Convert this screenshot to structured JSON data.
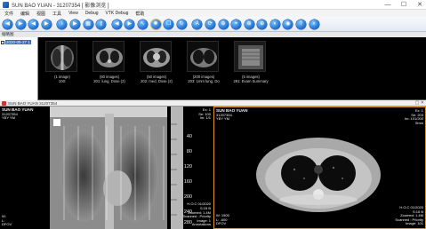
{
  "window": {
    "title": "SUN BAO YUAN - 31207354 [ 影像浏览 ]",
    "minimize": "—",
    "maximize": "☐",
    "close": "✕"
  },
  "menu": [
    "文件",
    "编辑",
    "视图",
    "工具",
    "View",
    "Debug",
    "VTK Debug",
    "帮助"
  ],
  "toolbar": {
    "buttons": [
      {
        "icon": "arrow-left-icon"
      },
      {
        "icon": "arrow-right-icon"
      },
      {
        "icon": "arrow-left-icon"
      },
      {
        "icon": "arrow-right-icon"
      },
      {
        "icon": "info-icon"
      },
      {
        "icon": "arrow-right-icon"
      },
      {
        "icon": "layout-icon"
      },
      {
        "icon": "key-icon"
      },
      {
        "icon": "arrow-left-icon"
      },
      {
        "icon": "arrow-right-icon"
      },
      {
        "icon": "pointer-icon"
      },
      {
        "icon": "settings-icon"
      },
      {
        "icon": "copy-icon"
      },
      {
        "icon": "rotate-icon"
      },
      {
        "icon": "text-a-icon"
      },
      {
        "icon": "refresh-icon"
      },
      {
        "icon": "zoom-icon"
      },
      {
        "icon": "measure-icon"
      },
      {
        "icon": "zoom-icon"
      },
      {
        "icon": "zoom-icon"
      },
      {
        "icon": "contrast-icon"
      },
      {
        "icon": "camera-icon"
      },
      {
        "icon": "help-icon"
      },
      {
        "icon": "search-icon"
      }
    ]
  },
  "thumbnails": {
    "panel_label": "缩略图",
    "study_date": "2020-05-27 1",
    "items": [
      {
        "count": "(1 image)",
        "label": "100:"
      },
      {
        "count": "(50 images)",
        "label": "201: lung, Dose (2)"
      },
      {
        "count": "(50 images)",
        "label": "202: med, Dose (2)"
      },
      {
        "count": "(200 images)",
        "label": "203: 1mm lung, Do"
      },
      {
        "count": "(5 images)",
        "label": "291: Exam Summary"
      }
    ]
  },
  "viewer": {
    "bar_title": "SUN BAO YUAN  31207354",
    "bar_controls": "▢ ✕",
    "left": {
      "tl": [
        "SUN BAO YUAN",
        "31207354",
        "YBY YM"
      ],
      "tr": [
        "Ex: 1",
        "Se: 100",
        "Im: 1/1"
      ],
      "bl": [
        "W:",
        "L:",
        "DFOV"
      ],
      "br": [
        "H.O.C 01/2020",
        "S:15 B",
        "Zoomed: 1.4M",
        "Scanned : Priority",
        "Image: 1",
        "Annotations"
      ],
      "ruler": [
        "40",
        "80",
        "120",
        "160",
        "200",
        "240",
        "280"
      ]
    },
    "right": {
      "tl": [
        "SUN BAO YUAN",
        "31207354",
        "YBY YM"
      ],
      "tr": [
        "Ex: 1",
        "Se: 203",
        "Im: 101/200",
        "5mm"
      ],
      "bl": [
        "W: 1500",
        "L: -600",
        "DFOV"
      ],
      "br": [
        "H.O.C 01/2020",
        "S:15 B",
        "Zoomed: 1.4M",
        "Scanned : Priority",
        "Image: 101"
      ]
    }
  },
  "colors": {
    "accent": "#1b6fd1",
    "active_viewport_border": "#e09520"
  }
}
